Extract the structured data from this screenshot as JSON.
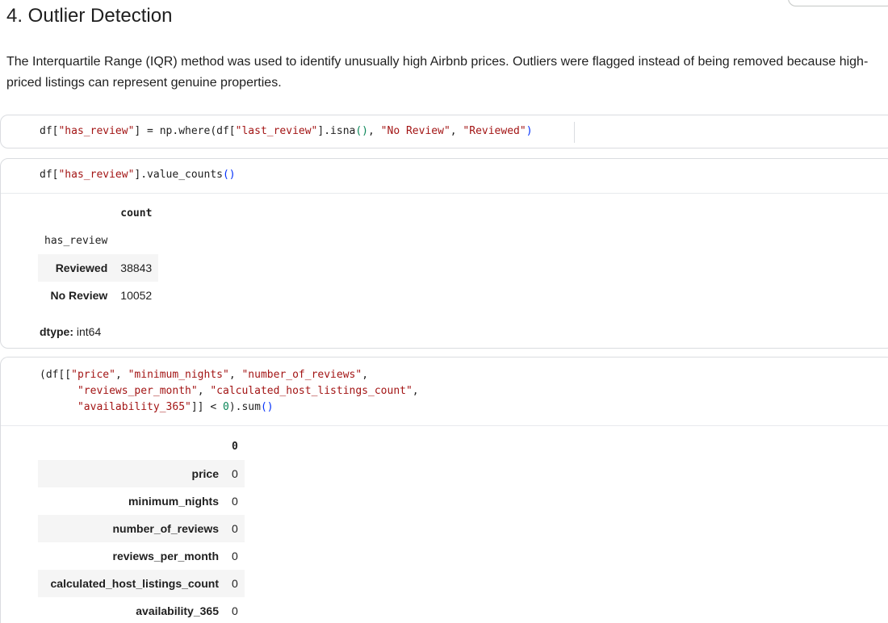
{
  "markdown": {
    "heading": "4. Outlier Detection",
    "paragraph": "The Interquartile Range (IQR) method was used to identify unusually high Airbnb prices. Outliers were flagged instead of being removed because high-priced listings can represent genuine properties."
  },
  "cell1": {
    "code_parts": [
      "df[",
      "\"has_review\"",
      "] = np.where(df[",
      "\"last_review\"",
      "].isna",
      "()",
      ", ",
      "\"No Review\"",
      ", ",
      "\"Reviewed\"",
      ")"
    ]
  },
  "cell2": {
    "code_parts": [
      "df[",
      "\"has_review\"",
      "].value_counts",
      "()"
    ],
    "output": {
      "column_header": "count",
      "index_name": "has_review",
      "rows": [
        {
          "label": "Reviewed",
          "value": "38843"
        },
        {
          "label": "No Review",
          "value": "10052"
        }
      ],
      "dtype_label": "dtype:",
      "dtype_value": " int64"
    }
  },
  "cell3": {
    "code_lines": [
      [
        "(df[[",
        "\"price\"",
        ", ",
        "\"minimum_nights\"",
        ", ",
        "\"number_of_reviews\"",
        ","
      ],
      [
        "      ",
        "\"reviews_per_month\"",
        ", ",
        "\"calculated_host_listings_count\"",
        ","
      ],
      [
        "      ",
        "\"availability_365\"",
        "]] < ",
        "0",
        ").sum",
        "()"
      ]
    ],
    "output": {
      "column_header": "0",
      "rows": [
        {
          "label": "price",
          "value": "0"
        },
        {
          "label": "minimum_nights",
          "value": "0"
        },
        {
          "label": "number_of_reviews",
          "value": "0"
        },
        {
          "label": "reviews_per_month",
          "value": "0"
        },
        {
          "label": "calculated_host_listings_count",
          "value": "0"
        },
        {
          "label": "availability_365",
          "value": "0"
        }
      ]
    }
  }
}
